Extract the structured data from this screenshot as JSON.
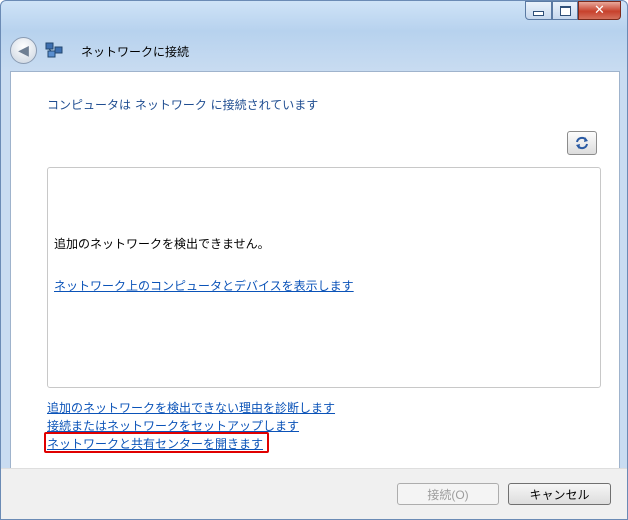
{
  "window": {
    "title": "ネットワークに接続",
    "caption_buttons": {
      "minimize": "minimize",
      "maximize": "maximize",
      "close": "✕"
    }
  },
  "content": {
    "status_heading": "コンピュータは ネットワーク に接続されています",
    "network_list": {
      "message": "追加のネットワークを検出できません。",
      "view_link": "ネットワーク上のコンピュータとデバイスを表示します"
    },
    "links": {
      "diagnose": "追加のネットワークを検出できない理由を診断します",
      "setup": "接続またはネットワークをセットアップします",
      "network_center": "ネットワークと共有センターを開きます"
    }
  },
  "footer": {
    "connect_label": "接続(O)",
    "cancel_label": "キャンセル"
  },
  "colors": {
    "heading": "#1f4d91",
    "link": "#0b53b8",
    "highlight": "#e00000"
  }
}
